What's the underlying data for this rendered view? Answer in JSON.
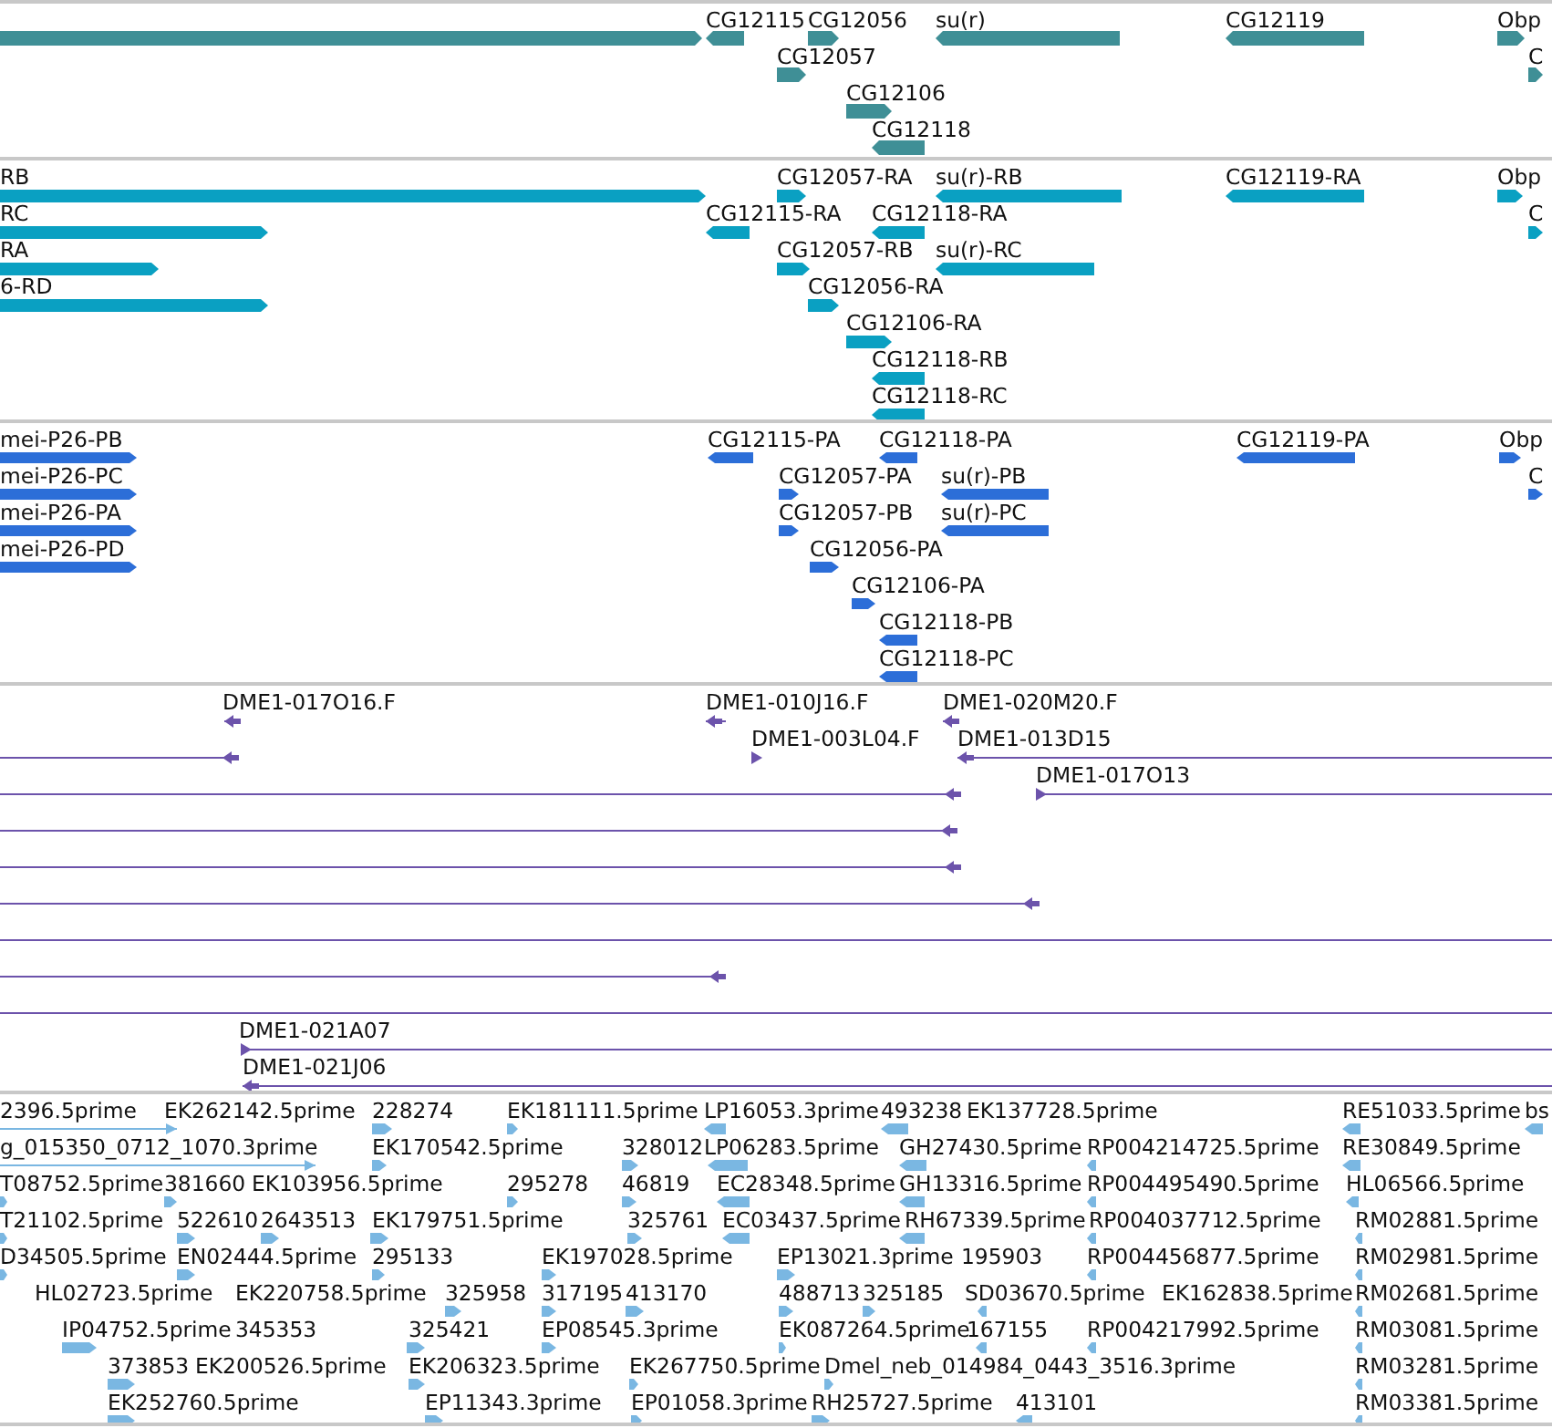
{
  "tracks": [
    {
      "kind": "gene",
      "lanes": [
        [
          {
            "reverse": false
          },
          {
            "label": "CG12115",
            "reverse": true
          },
          {
            "label": "CG12056",
            "reverse": false
          },
          {
            "label": "su(r)",
            "reverse": true
          },
          {
            "label": "CG12119",
            "reverse": true
          },
          {
            "label": "Obp",
            "reverse": false
          }
        ],
        [
          {
            "label": "CG12057",
            "reverse": false
          },
          {
            "label": "C",
            "reverse": false
          }
        ],
        [
          {
            "label": "CG12106",
            "reverse": false
          }
        ],
        [
          {
            "label": "CG12118",
            "reverse": true
          }
        ]
      ]
    },
    {
      "kind": "transcript",
      "lanes": [
        [
          {
            "label": "RB",
            "reverse": false
          },
          {
            "label": "CG12057-RA",
            "reverse": false
          },
          {
            "label": "su(r)-RB",
            "reverse": true
          },
          {
            "label": "CG12119-RA",
            "reverse": true
          },
          {
            "label": "Obp",
            "reverse": false
          }
        ],
        [
          {
            "label": "RC",
            "reverse": false
          },
          {
            "label": "CG12115-RA",
            "reverse": true
          },
          {
            "label": "CG12118-RA",
            "reverse": true
          },
          {
            "label": "C",
            "reverse": false
          }
        ],
        [
          {
            "label": "RA",
            "reverse": false
          },
          {
            "label": "CG12057-RB",
            "reverse": false
          },
          {
            "label": "su(r)-RC",
            "reverse": true
          }
        ],
        [
          {
            "label": "6-RD",
            "reverse": false
          },
          {
            "label": "CG12056-RA",
            "reverse": false
          }
        ],
        [
          {
            "label": "CG12106-RA",
            "reverse": false
          }
        ],
        [
          {
            "label": "CG12118-RB",
            "reverse": true
          }
        ],
        [
          {
            "label": "CG12118-RC",
            "reverse": true
          }
        ]
      ]
    },
    {
      "kind": "protein",
      "lanes": [
        [
          {
            "label": "mei-P26-PB",
            "reverse": false
          },
          {
            "label": "CG12115-PA",
            "reverse": true
          },
          {
            "label": "CG12118-PA",
            "reverse": true
          },
          {
            "label": "CG12119-PA",
            "reverse": true
          },
          {
            "label": "Obp",
            "reverse": false
          }
        ],
        [
          {
            "label": "mei-P26-PC",
            "reverse": false
          },
          {
            "label": "CG12057-PA",
            "reverse": false
          },
          {
            "label": "su(r)-PB",
            "reverse": true
          },
          {
            "label": "C",
            "reverse": false
          }
        ],
        [
          {
            "label": "mei-P26-PA",
            "reverse": false
          },
          {
            "label": "CG12057-PB",
            "reverse": false
          },
          {
            "label": "su(r)-PC",
            "reverse": true
          }
        ],
        [
          {
            "label": "mei-P26-PD",
            "reverse": false
          },
          {
            "label": "CG12056-PA",
            "reverse": false
          }
        ],
        [
          {
            "label": "CG12106-PA",
            "reverse": false
          }
        ],
        [
          {
            "label": "CG12118-PB",
            "reverse": true
          }
        ],
        [
          {
            "label": "CG12118-PC",
            "reverse": true
          }
        ]
      ]
    },
    {
      "kind": "clone",
      "lanes": [
        [
          {
            "kind": "read",
            "label": "DME1-017O16.F",
            "reverse": true
          },
          {
            "kind": "read",
            "label": "DME1-010J16.F",
            "reverse": true
          },
          {
            "kind": "read",
            "label": "DME1-020M20.F",
            "reverse": true
          }
        ],
        [
          {
            "kind": "read",
            "reverse": true
          },
          {
            "kind": "read",
            "label": "DME1-003L04.F",
            "reverse": false
          },
          {
            "kind": "read",
            "label": "DME1-013D15",
            "reverse": true
          }
        ],
        [
          {
            "kind": "read",
            "reverse": true
          },
          {
            "kind": "read",
            "label": "DME1-017O13",
            "reverse": false
          }
        ],
        [
          {
            "kind": "read",
            "reverse": true
          }
        ],
        [
          {
            "kind": "read",
            "reverse": true
          }
        ],
        [
          {
            "kind": "read",
            "reverse": true
          }
        ],
        [
          {
            "kind": "span"
          }
        ],
        [
          {
            "kind": "read",
            "reverse": true
          }
        ],
        [
          {
            "kind": "span"
          }
        ],
        [
          {
            "kind": "read",
            "label": "DME1-021A07",
            "reverse": false
          }
        ],
        [
          {
            "kind": "read",
            "label": "DME1-021J06",
            "reverse": true
          }
        ]
      ]
    },
    {
      "kind": "est",
      "lanes": [
        [
          {
            "label": "2396.5prime",
            "reverse": false
          },
          {
            "label": "EK262142.5prime"
          },
          {
            "label": "228274",
            "reverse": false
          },
          {
            "label": "EK181111.5prime",
            "reverse": false
          },
          {
            "label": "LP16053.3prime",
            "reverse": true
          },
          {
            "label": "493238",
            "reverse": true
          },
          {
            "label": "EK137728.5prime"
          },
          {
            "label": "RE51033.5prime",
            "reverse": true
          },
          {
            "label": "bs",
            "reverse": true
          }
        ],
        [
          {
            "label": "g_015350_0712_1070.3prime",
            "reverse": false
          },
          {
            "label": "EK170542.5prime",
            "reverse": false
          },
          {
            "label": "328012",
            "reverse": false
          },
          {
            "label": "LP06283.5prime",
            "reverse": true
          },
          {
            "label": "GH27430.5prime",
            "reverse": true
          },
          {
            "label": "RP004214725.5prime",
            "reverse": true
          },
          {
            "label": "RE30849.5prime",
            "reverse": true
          }
        ],
        [
          {
            "label": "T08752.5prime",
            "reverse": false
          },
          {
            "label": "381660",
            "reverse": false
          },
          {
            "label": "EK103956.5prime"
          },
          {
            "label": "295278",
            "reverse": false
          },
          {
            "label": "46819",
            "reverse": false
          },
          {
            "label": "EC28348.5prime",
            "reverse": true
          },
          {
            "label": "GH13316.5prime",
            "reverse": true
          },
          {
            "label": "RP004495490.5prime",
            "reverse": true
          },
          {
            "label": "HL06566.5prime",
            "reverse": true
          }
        ],
        [
          {
            "label": "T21102.5prime",
            "reverse": false
          },
          {
            "label": "522610",
            "reverse": false
          },
          {
            "label": "2643513",
            "reverse": false
          },
          {
            "label": "EK179751.5prime",
            "reverse": false
          },
          {
            "label": "325761",
            "reverse": false
          },
          {
            "label": "EC03437.5prime",
            "reverse": true
          },
          {
            "label": "RH67339.5prime",
            "reverse": true
          },
          {
            "label": "RP004037712.5prime",
            "reverse": true
          },
          {
            "label": "RM02881.5prime",
            "reverse": true
          }
        ],
        [
          {
            "label": "D34505.5prime",
            "reverse": false
          },
          {
            "label": "EN02444.5prime",
            "reverse": false
          },
          {
            "label": "295133",
            "reverse": false
          },
          {
            "label": "EK197028.5prime",
            "reverse": false
          },
          {
            "label": "EP13021.3prime",
            "reverse": false
          },
          {
            "label": "195903"
          },
          {
            "label": "RP004456877.5prime",
            "reverse": true
          },
          {
            "label": "RM02981.5prime",
            "reverse": true
          }
        ],
        [
          {
            "label": "HL02723.5prime"
          },
          {
            "label": "EK220758.5prime"
          },
          {
            "label": "325958",
            "reverse": false
          },
          {
            "label": "317195",
            "reverse": false
          },
          {
            "label": "413170",
            "reverse": false
          },
          {
            "label": "488713",
            "reverse": false
          },
          {
            "label": "325185",
            "reverse": false
          },
          {
            "label": "SD03670.5prime",
            "reverse": true
          },
          {
            "label": "EK162838.5prime"
          },
          {
            "label": "RM02681.5prime",
            "reverse": true
          }
        ],
        [
          {
            "label": "IP04752.5prime",
            "reverse": false
          },
          {
            "label": "345353"
          },
          {
            "label": "325421",
            "reverse": false
          },
          {
            "label": "EP08545.3prime",
            "reverse": false
          },
          {
            "label": "EK087264.5prime",
            "reverse": false
          },
          {
            "label": "167155",
            "reverse": true
          },
          {
            "label": "RP004217992.5prime",
            "reverse": true
          },
          {
            "label": "RM03081.5prime",
            "reverse": true
          }
        ],
        [
          {
            "label": "373853",
            "reverse": false
          },
          {
            "label": "EK200526.5prime"
          },
          {
            "label": "EK206323.5prime",
            "reverse": false
          },
          {
            "label": "EK267750.5prime",
            "reverse": false
          },
          {
            "label": "Dmel_neb_014984_0443_3516.3prime",
            "reverse": false
          },
          {
            "label": "RM03281.5prime",
            "reverse": true
          }
        ],
        [
          {
            "label": "EK252760.5prime",
            "reverse": false
          },
          {
            "label": "EP11343.3prime",
            "reverse": false
          },
          {
            "label": "EP01058.3prime",
            "reverse": false
          },
          {
            "label": "RH25727.5prime",
            "reverse": false
          },
          {
            "label": "413101",
            "reverse": true
          },
          {
            "label": "RM03381.5prime",
            "reverse": true
          }
        ]
      ]
    }
  ]
}
